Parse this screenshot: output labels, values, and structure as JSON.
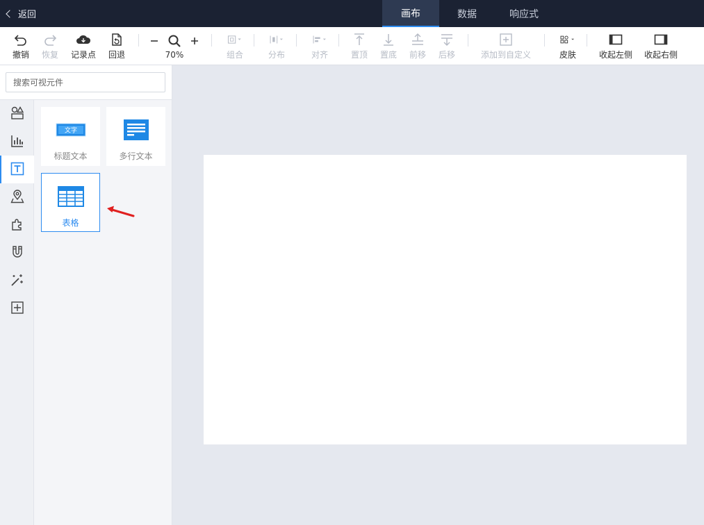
{
  "topbar": {
    "back_label": "返回",
    "tabs": [
      {
        "label": "画布",
        "active": true
      },
      {
        "label": "数据",
        "active": false
      },
      {
        "label": "响应式",
        "active": false
      }
    ]
  },
  "toolbar": {
    "undo": "撤销",
    "redo": "恢复",
    "record": "记录点",
    "rollback": "回退",
    "zoom": "70%",
    "group": "组合",
    "distribute": "分布",
    "align": "对齐",
    "to_top": "置顶",
    "to_bottom": "置底",
    "forward": "前移",
    "backward": "后移",
    "add_custom": "添加到自定义",
    "skin": "皮肤",
    "collapse_left": "收起左侧",
    "collapse_right": "收起右侧"
  },
  "search": {
    "placeholder": "搜索可视元件"
  },
  "strip": {
    "icons": [
      "shapes-icon",
      "chart-icon",
      "text-icon",
      "map-icon",
      "plugin-icon",
      "magnet-icon",
      "magic-wand-icon",
      "custom-add-icon"
    ],
    "active_index": 2
  },
  "components": [
    {
      "label": "标题文本",
      "icon_text": "文字"
    },
    {
      "label": "多行文本"
    },
    {
      "label": "表格",
      "selected": true
    }
  ],
  "colors": {
    "accent": "#2d8cf0",
    "topbar": "#1b2233",
    "annotation": "#e02020"
  }
}
